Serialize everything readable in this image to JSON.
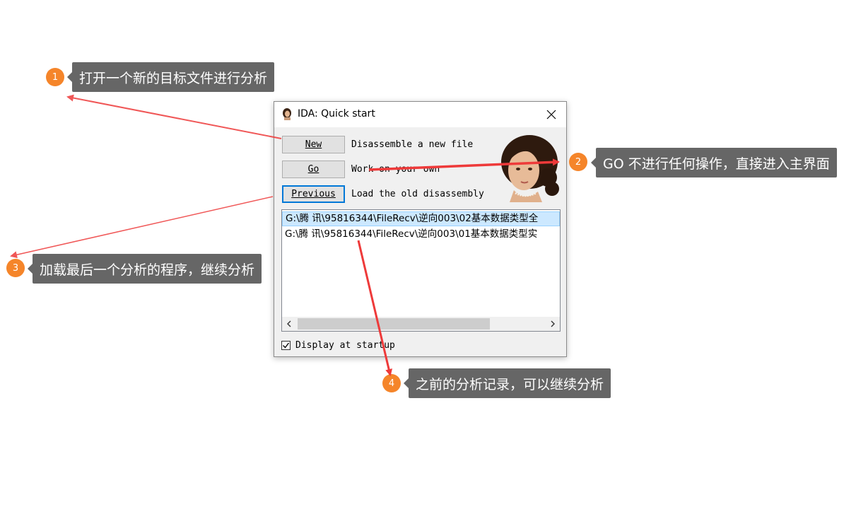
{
  "dialog": {
    "title": "IDA: Quick start",
    "buttons": [
      {
        "label": "New",
        "description": "Disassemble a new file"
      },
      {
        "label": "Go",
        "description": "Work on your own"
      },
      {
        "label": "Previous",
        "description": "Load the old disassembly"
      }
    ],
    "recent_files": [
      "G:\\腾 讯\\95816344\\FileRecv\\逆向003\\02基本数据类型全",
      "G:\\腾 讯\\95816344\\FileRecv\\逆向003\\01基本数据类型实"
    ],
    "display_at_startup_label": "Display at startup",
    "display_at_startup_checked": true
  },
  "callouts": [
    {
      "number": "1",
      "text": "打开一个新的目标文件进行分析"
    },
    {
      "number": "2",
      "text": "GO 不进行任何操作，直接进入主界面"
    },
    {
      "number": "3",
      "text": "加载最后一个分析的程序，继续分析"
    },
    {
      "number": "4",
      "text": "之前的分析记录，可以继续分析"
    }
  ],
  "colors": {
    "badge": "#f5852a",
    "tooltip": "#666666",
    "arrow": "#ee3a3a",
    "selection": "#cce8ff"
  }
}
